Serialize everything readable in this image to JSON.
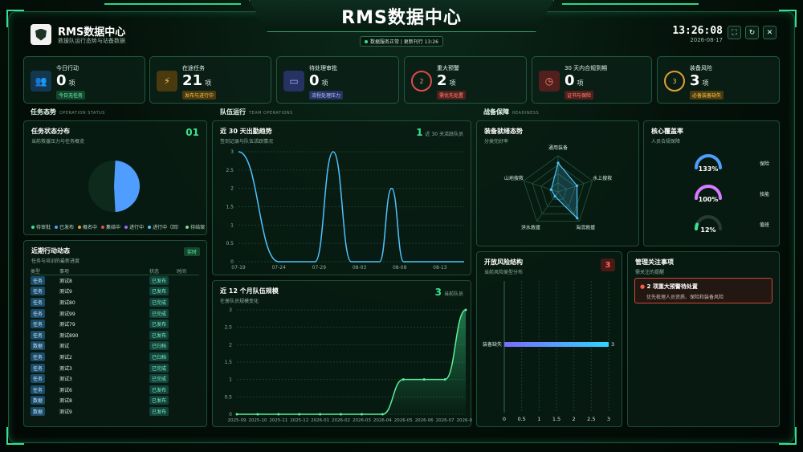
{
  "header": {
    "title": "RMS数据中心",
    "app_name": "RMS数据中心",
    "app_subtitle": "救援队运行态势与站备数据",
    "status": "数据服务正常 | 更新刊行 13:26",
    "time": "13:26:08",
    "date": "2026-08-17"
  },
  "kpis": [
    {
      "label": "今日行动",
      "value": "0",
      "unit": "项",
      "tag": "今日无任务",
      "icon": "users-icon"
    },
    {
      "label": "在途任务",
      "value": "21",
      "unit": "项",
      "tag": "发布与进行中",
      "icon": "lightning-icon"
    },
    {
      "label": "待处理审批",
      "value": "0",
      "unit": "项",
      "tag": "流程处理压力",
      "icon": "book-icon"
    },
    {
      "label": "重大预警",
      "value": "2",
      "unit": "项",
      "tag": "需优先处置",
      "icon": "warning-ring-icon",
      "ring": "2"
    },
    {
      "label": "30 天内合规到期",
      "value": "0",
      "unit": "项",
      "tag": "证书与保险",
      "icon": "clock-icon"
    },
    {
      "label": "装备风险",
      "value": "3",
      "unit": "项",
      "tag": "必备装备缺失",
      "icon": "risk-ring-icon",
      "ring": "3"
    }
  ],
  "sections": {
    "ops": {
      "title": "任务态势",
      "en": "OPERATION STATUS"
    },
    "team": {
      "title": "队伍运行",
      "en": "TEAM OPERATIONS"
    },
    "ready": {
      "title": "战备保障",
      "en": "READINESS"
    }
  },
  "task_dist": {
    "title": "任务状态分布",
    "subtitle": "当前救援压力与任务概览",
    "count": "01",
    "legend": [
      {
        "label": "待审批",
        "color": "#3be38f"
      },
      {
        "label": "已发布",
        "color": "#4f9dff"
      },
      {
        "label": "概名中",
        "color": "#f0a030"
      },
      {
        "label": "集结中",
        "color": "#e05050"
      },
      {
        "label": "进行中",
        "color": "#9b6bff"
      },
      {
        "label": "进行中（回）",
        "color": "#4fc3ff"
      },
      {
        "label": "待结案",
        "color": "#8ad38a"
      }
    ]
  },
  "recent": {
    "title": "近期行动动态",
    "subtitle": "任务与培训的最新进度",
    "badge": "实时",
    "headers": [
      "类型",
      "事项",
      "状态",
      "时间"
    ],
    "rows": [
      {
        "type": "任务",
        "item": "测试8",
        "status": "已发布"
      },
      {
        "type": "任务",
        "item": "测试9",
        "status": "已发布"
      },
      {
        "type": "任务",
        "item": "测试80",
        "status": "已完成"
      },
      {
        "type": "任务",
        "item": "测试99",
        "status": "已完成"
      },
      {
        "type": "任务",
        "item": "测试79",
        "status": "已发布"
      },
      {
        "type": "任务",
        "item": "测试890",
        "status": "已发布"
      },
      {
        "type": "数据",
        "item": "测试",
        "status": "已归档"
      },
      {
        "type": "任务",
        "item": "测试2",
        "status": "已归档"
      },
      {
        "type": "任务",
        "item": "测试3",
        "status": "已完成"
      },
      {
        "type": "任务",
        "item": "测试3",
        "status": "已完成"
      },
      {
        "type": "任务",
        "item": "测试6",
        "status": "已发布"
      },
      {
        "type": "数据",
        "item": "测试8",
        "status": "已发布"
      },
      {
        "type": "数据",
        "item": "测试9",
        "status": "已发布"
      }
    ]
  },
  "attendance": {
    "title": "近 30 天出勤趋势",
    "subtitle": "签到记录与队伍活跃情况",
    "value": "1",
    "note": "近 30 天活跃队员"
  },
  "team_scale": {
    "title": "近 12 个月队伍规模",
    "subtitle": "在册队员规模变化",
    "value": "3",
    "note": "当前队员"
  },
  "equip_radar": {
    "title": "装备就绪态势",
    "subtitle": "分类完好率"
  },
  "coverage": {
    "title": "核心覆盖率",
    "subtitle": "人员合规保障",
    "items": [
      {
        "value": "133%",
        "label": "保险",
        "color": "#4f9dff",
        "pct": 1.0
      },
      {
        "value": "100%",
        "label": "技能",
        "color": "#d77bff",
        "pct": 1.0
      },
      {
        "value": "12%",
        "label": "值班",
        "color": "#3be38f",
        "pct": 0.12
      }
    ]
  },
  "risk": {
    "title": "开放风险结构",
    "subtitle": "当前风险类型分布",
    "count": "3"
  },
  "focus": {
    "title": "管理关注事项",
    "subtitle": "需关注的提醒",
    "alert_title": "2 项重大预警待处置",
    "alert_text": "优先梳理人员资质、保险和装备风险"
  },
  "chart_data": [
    {
      "type": "pie",
      "title": "任务状态分布",
      "slices": [
        {
          "label": "已发布",
          "value": 1
        }
      ]
    },
    {
      "type": "line",
      "title": "近 30 天出勤趋势",
      "x": [
        "07-19",
        "07-24",
        "07-29",
        "08-03",
        "08-08",
        "08-13"
      ],
      "ylim": [
        0,
        3
      ],
      "yticks": [
        "0",
        "0.5",
        "1",
        "1.5",
        "2",
        "2.5",
        "3"
      ],
      "series": [
        {
          "points": [
            [
              0,
              3
            ],
            [
              1.0,
              0
            ],
            [
              1.9,
              0
            ],
            [
              2.35,
              3
            ],
            [
              2.8,
              0
            ],
            [
              3.5,
              0
            ],
            [
              3.8,
              2
            ],
            [
              4.1,
              0
            ],
            [
              5.6,
              0
            ]
          ]
        }
      ]
    },
    {
      "type": "area",
      "title": "近 12 个月队伍规模",
      "categories": [
        "2025-09",
        "2025-10",
        "2025-11",
        "2025-12",
        "2026-01",
        "2026-02",
        "2026-03",
        "2026-04",
        "2026-05",
        "2026-06",
        "2026-07",
        "2026-08"
      ],
      "values": [
        0,
        0,
        0,
        0,
        0,
        0,
        0,
        0,
        1,
        1,
        1,
        3
      ],
      "ylim": [
        0,
        3
      ],
      "yticks": [
        "0",
        "0.5",
        "1",
        "1.5",
        "2",
        "2.5",
        "3"
      ]
    },
    {
      "type": "radar",
      "title": "装备就绪态势",
      "axes": [
        "通用装备",
        "水上搜救",
        "海滨救援",
        "洪水救援",
        "山地搜救"
      ],
      "values": [
        0.8,
        0.55,
        0.9,
        0.15,
        0.2
      ]
    },
    {
      "type": "bar",
      "title": "开放风险结构",
      "categories": [
        "装备缺失"
      ],
      "values": [
        3
      ],
      "xlim": [
        0,
        3
      ],
      "xticks": [
        "0",
        "0.5",
        "1",
        "1.5",
        "2",
        "2.5",
        "3"
      ]
    }
  ]
}
